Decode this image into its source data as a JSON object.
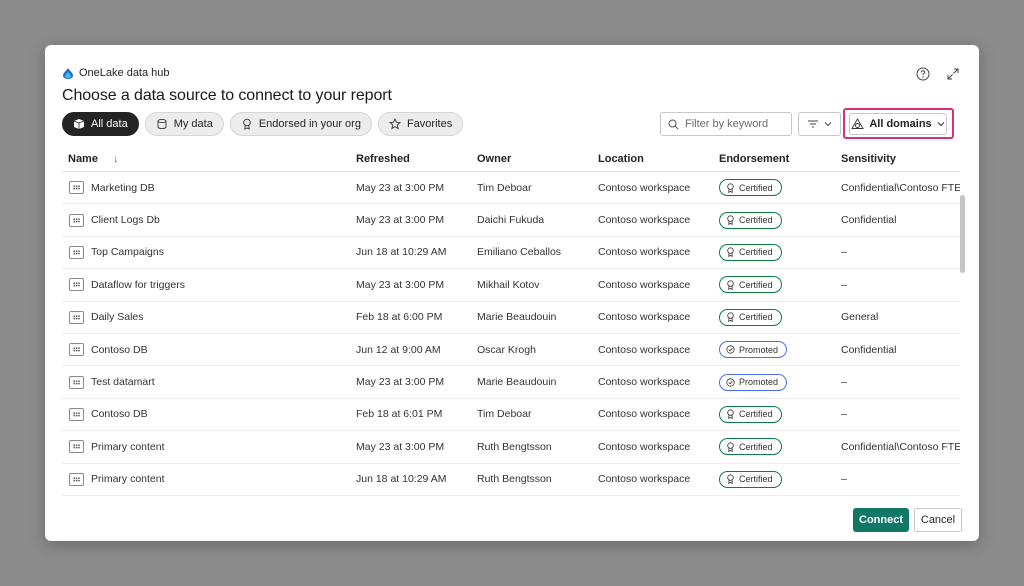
{
  "header": {
    "hub_label": "OneLake data hub",
    "title": "Choose a data source to connect to your report"
  },
  "filters": {
    "pills": [
      {
        "label": "All data",
        "icon": "all-data-icon",
        "active": true
      },
      {
        "label": "My data",
        "icon": "database-icon",
        "active": false
      },
      {
        "label": "Endorsed in your org",
        "icon": "ribbon-icon",
        "active": false
      },
      {
        "label": "Favorites",
        "icon": "star-icon",
        "active": false
      }
    ],
    "search_placeholder": "Filter by keyword",
    "domains_label": "All domains"
  },
  "table": {
    "columns": [
      "Name",
      "Refreshed",
      "Owner",
      "Location",
      "Endorsement",
      "Sensitivity"
    ],
    "rows": [
      {
        "name": "Marketing DB",
        "refreshed": "May 23 at 3:00 PM",
        "owner": "Tim Deboar",
        "location": "Contoso workspace",
        "endorsement": "Certified",
        "sensitivity": "Confidential\\Contoso FTE"
      },
      {
        "name": "Client Logs Db",
        "refreshed": "May 23 at 3:00 PM",
        "owner": "Daichi Fukuda",
        "location": "Contoso workspace",
        "endorsement": "Certified",
        "sensitivity": "Confidential"
      },
      {
        "name": "Top Campaigns",
        "refreshed": "Jun 18 at 10:29 AM",
        "owner": "Emiliano Ceballos",
        "location": "Contoso workspace",
        "endorsement": "Certified",
        "sensitivity": "–"
      },
      {
        "name": "Dataflow for triggers",
        "refreshed": "May 23 at 3:00 PM",
        "owner": "Mikhail Kotov",
        "location": "Contoso workspace",
        "endorsement": "Certified",
        "sensitivity": "–"
      },
      {
        "name": "Daily Sales",
        "refreshed": "Feb 18 at 6:00 PM",
        "owner": "Marie Beaudouin",
        "location": "Contoso workspace",
        "endorsement": "Certified",
        "sensitivity": "General"
      },
      {
        "name": "Contoso DB",
        "refreshed": "Jun 12 at 9:00 AM",
        "owner": "Oscar Krogh",
        "location": "Contoso workspace",
        "endorsement": "Promoted",
        "sensitivity": "Confidential"
      },
      {
        "name": "Test datamart",
        "refreshed": "May 23 at 3:00 PM",
        "owner": "Marie Beaudouin",
        "location": "Contoso workspace",
        "endorsement": "Promoted",
        "sensitivity": "–"
      },
      {
        "name": "Contoso DB",
        "refreshed": "Feb 18 at 6:01 PM",
        "owner": "Tim Deboar",
        "location": "Contoso workspace",
        "endorsement": "Certified",
        "sensitivity": "–"
      },
      {
        "name": "Primary content",
        "refreshed": "May 23 at 3:00 PM",
        "owner": "Ruth Bengtsson",
        "location": "Contoso workspace",
        "endorsement": "Certified",
        "sensitivity": "Confidential\\Contoso FTE"
      },
      {
        "name": "Primary content",
        "refreshed": "Jun 18 at 10:29 AM",
        "owner": "Ruth Bengtsson",
        "location": "Contoso workspace",
        "endorsement": "Certified",
        "sensitivity": "–"
      }
    ]
  },
  "footer": {
    "connect_label": "Connect",
    "cancel_label": "Cancel"
  },
  "colors": {
    "accent": "#117865",
    "highlight": "#d6307a",
    "certified": "#107c41",
    "promoted": "#4f6bed"
  }
}
